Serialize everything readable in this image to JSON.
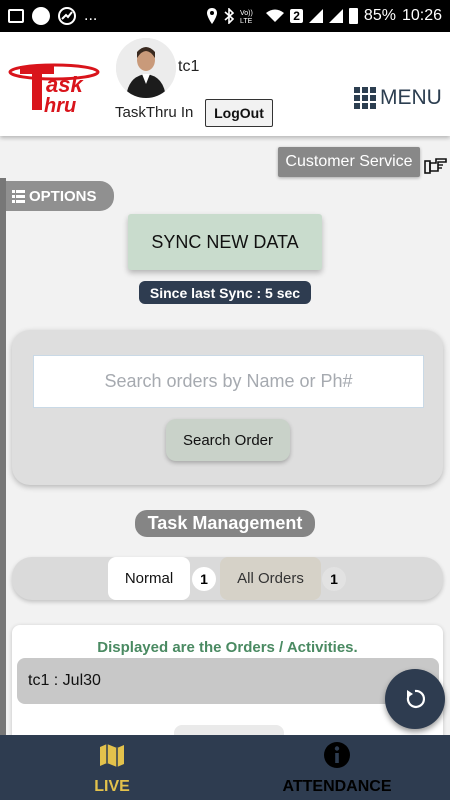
{
  "status_bar": {
    "wifi_badge": "2",
    "battery": "85%",
    "time": "10:26",
    "dots": "..."
  },
  "header": {
    "username": "tc1",
    "app_status": "TaskThru In",
    "logout_label": "LogOut",
    "menu_label": "MENU",
    "logo_text": "TaskThru"
  },
  "customer_service_label": "Customer Service",
  "options_label": "OPTIONS",
  "sync": {
    "button_label": "SYNC NEW DATA",
    "since_label": "Since last Sync : 5 sec"
  },
  "search": {
    "placeholder": "Search orders by Name or Ph#",
    "button_label": "Search Order"
  },
  "task_management": {
    "title": "Task Management",
    "tabs": [
      {
        "label": "Normal",
        "count": "1"
      },
      {
        "label": "All Orders",
        "count": "1"
      }
    ]
  },
  "orders": {
    "note": "Displayed are the Orders / Activities.",
    "rows": [
      {
        "label": "tc1 : Jul30"
      }
    ]
  },
  "bottom_nav": {
    "items": [
      {
        "label": "LIVE",
        "icon": "map-icon"
      },
      {
        "label": "ATTENDANCE",
        "icon": "info-icon"
      }
    ]
  },
  "colors": {
    "navy": "#2e3c50",
    "sync_green": "#c9dccd",
    "live_gold": "#e3c24c",
    "note_green": "#4a8a62",
    "logo_red": "#d9141b"
  }
}
